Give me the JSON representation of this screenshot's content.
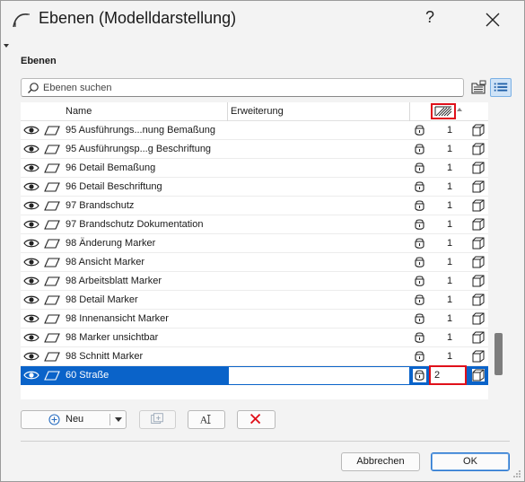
{
  "window": {
    "title": "Ebenen (Modelldarstellung)",
    "help_label": "?"
  },
  "section": {
    "label": "Ebenen"
  },
  "search": {
    "placeholder": "Ebenen suchen"
  },
  "table": {
    "columns": {
      "name": "Name",
      "extension": "Erweiterung"
    },
    "rows": [
      {
        "name": "95 Ausführungs...nung Bemaßung",
        "number": "1",
        "selected": false
      },
      {
        "name": "95 Ausführungsp...g Beschriftung",
        "number": "1",
        "selected": false
      },
      {
        "name": "96 Detail Bemaßung",
        "number": "1",
        "selected": false
      },
      {
        "name": "96 Detail Beschriftung",
        "number": "1",
        "selected": false
      },
      {
        "name": "97 Brandschutz",
        "number": "1",
        "selected": false
      },
      {
        "name": "97 Brandschutz Dokumentation",
        "number": "1",
        "selected": false
      },
      {
        "name": "98 Änderung Marker",
        "number": "1",
        "selected": false
      },
      {
        "name": "98 Ansicht Marker",
        "number": "1",
        "selected": false
      },
      {
        "name": "98 Arbeitsblatt Marker",
        "number": "1",
        "selected": false
      },
      {
        "name": "98 Detail Marker",
        "number": "1",
        "selected": false
      },
      {
        "name": "98 Innenansicht Marker",
        "number": "1",
        "selected": false
      },
      {
        "name": "98 Marker unsichtbar",
        "number": "1",
        "selected": false
      },
      {
        "name": "98 Schnitt Marker",
        "number": "1",
        "selected": false
      },
      {
        "name": "60 Straße",
        "number": "2",
        "selected": true
      }
    ]
  },
  "buttons": {
    "new_label": "Neu",
    "rename_label": "AⅠ",
    "cancel_label": "Abbrechen",
    "ok_label": "OK"
  },
  "colors": {
    "selection": "#0a63c9",
    "highlight_box": "#e0101a",
    "delete_icon": "#e0101a"
  }
}
